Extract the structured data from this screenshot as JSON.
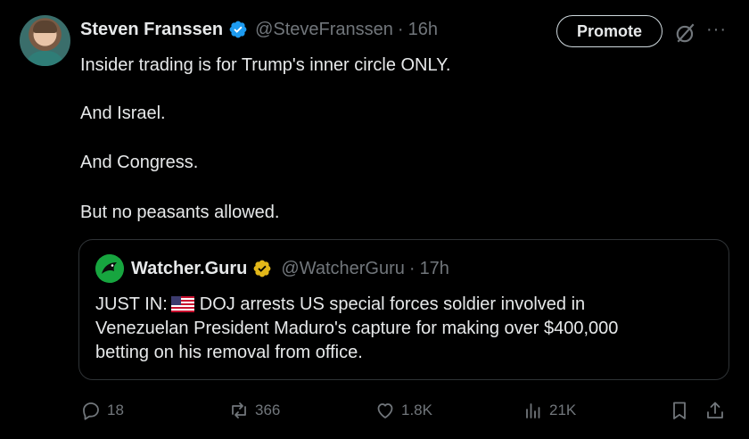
{
  "tweet": {
    "author_name": "Steven Franssen",
    "handle": "@SteveFranssen",
    "separator": "·",
    "time": "16h",
    "promote_label": "Promote",
    "more_label": "···",
    "lines": [
      "Insider trading is for Trump's inner circle ONLY.",
      "And Israel.",
      "And Congress.",
      "But no peasants allowed."
    ]
  },
  "quote": {
    "author_name": "Watcher.Guru",
    "handle": "@WatcherGuru",
    "separator": "·",
    "time": "17h",
    "prefix": "JUST IN:",
    "flag_icon": "us-flag-icon",
    "line1_rest": "DOJ arrests US special forces soldier involved in",
    "line2": "Venezuelan President Maduro's capture for making over $400,000",
    "line3": "betting on his removal from office."
  },
  "actions": {
    "replies": "18",
    "reposts": "366",
    "likes": "1.8K",
    "views": "21K"
  },
  "colors": {
    "background": "#000000",
    "text": "#e7e9ea",
    "muted": "#71767b",
    "verified_blue": "#1d9bf0",
    "verified_gold": "#e2b719",
    "border": "#2f3336"
  }
}
